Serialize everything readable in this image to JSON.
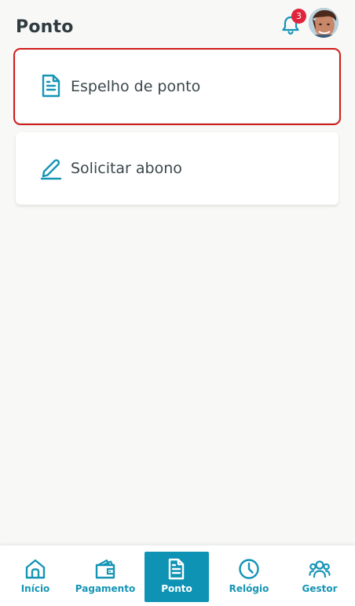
{
  "header": {
    "title": "Ponto",
    "notification_count": "3",
    "avatar_alt": "user-avatar"
  },
  "cards": [
    {
      "label": "Espelho de ponto",
      "icon": "document-icon",
      "selected": true
    },
    {
      "label": "Solicitar abono",
      "icon": "edit-icon",
      "selected": false
    }
  ],
  "bottom_nav": {
    "items": [
      {
        "label": "Início",
        "icon": "home-icon",
        "active": false
      },
      {
        "label": "Pagamento",
        "icon": "wallet-icon",
        "active": false
      },
      {
        "label": "Ponto",
        "icon": "document-icon",
        "active": true
      },
      {
        "label": "Relógio",
        "icon": "clock-icon",
        "active": false
      },
      {
        "label": "Gestor",
        "icon": "users-icon",
        "active": false
      }
    ]
  },
  "colors": {
    "accent": "#1595b5",
    "active_bg": "#0f93b4",
    "badge": "#e1243b",
    "selection_outline": "#d21d1d",
    "background": "#f8f8f7"
  }
}
